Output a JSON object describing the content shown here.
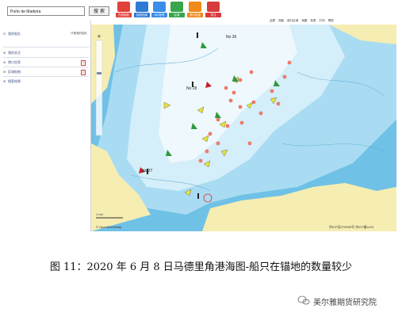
{
  "search": {
    "value": "Porto de Madeira",
    "button_label": "搜 索"
  },
  "toolbar": {
    "tools": [
      {
        "name": "tool-1",
        "label": "在线船舶",
        "color": "#e2403a"
      },
      {
        "name": "tool-2",
        "label": "船舶档案",
        "color": "#2e7bd6"
      },
      {
        "name": "tool-3",
        "label": "AIS信号",
        "color": "#3b8ee8"
      },
      {
        "name": "tool-4",
        "label": "区域",
        "color": "#3aa64c"
      },
      {
        "name": "tool-5",
        "label": "港口信息",
        "color": "#ef8a1c"
      },
      {
        "name": "tool-6",
        "label": "关注",
        "color": "#d83b3b"
      }
    ]
  },
  "map_toolbar": {
    "items": [
      "全屏",
      "测距",
      "航行区域",
      "海图",
      "标签",
      "打印",
      "帮助"
    ]
  },
  "sidebar": {
    "rows": [
      {
        "label": "我的船队",
        "sub": "只看我的船队"
      },
      {
        "label": "我的关注",
        "sub": ""
      },
      {
        "label": "港口信息",
        "badge": "0"
      },
      {
        "label": "区域船舶",
        "badge": "0"
      },
      {
        "label": "搜索结果",
        "sub": ""
      }
    ]
  },
  "map": {
    "labels": [
      "No 26",
      "No 28",
      "No 27"
    ],
    "scale_label": "1 nm",
    "attribution_left": "© OpenStreetMap",
    "attribution_right": "京ICP证070599号  京ICP备1124"
  },
  "caption": "图 11：2020 年 6 月 8 日马德里角港海图-船只在锚地的数量较少",
  "watermark": "美尔雅期货研究院",
  "colors": {
    "sea_deep": "#6fc1e6",
    "sea_mid": "#a9dcf2",
    "sea_shallow": "#d4eefa",
    "sea_channel": "#eef8fd",
    "land": "#f6edb2",
    "anchored_ship": "#f07a68",
    "moving_ship": "#e8e23a"
  }
}
